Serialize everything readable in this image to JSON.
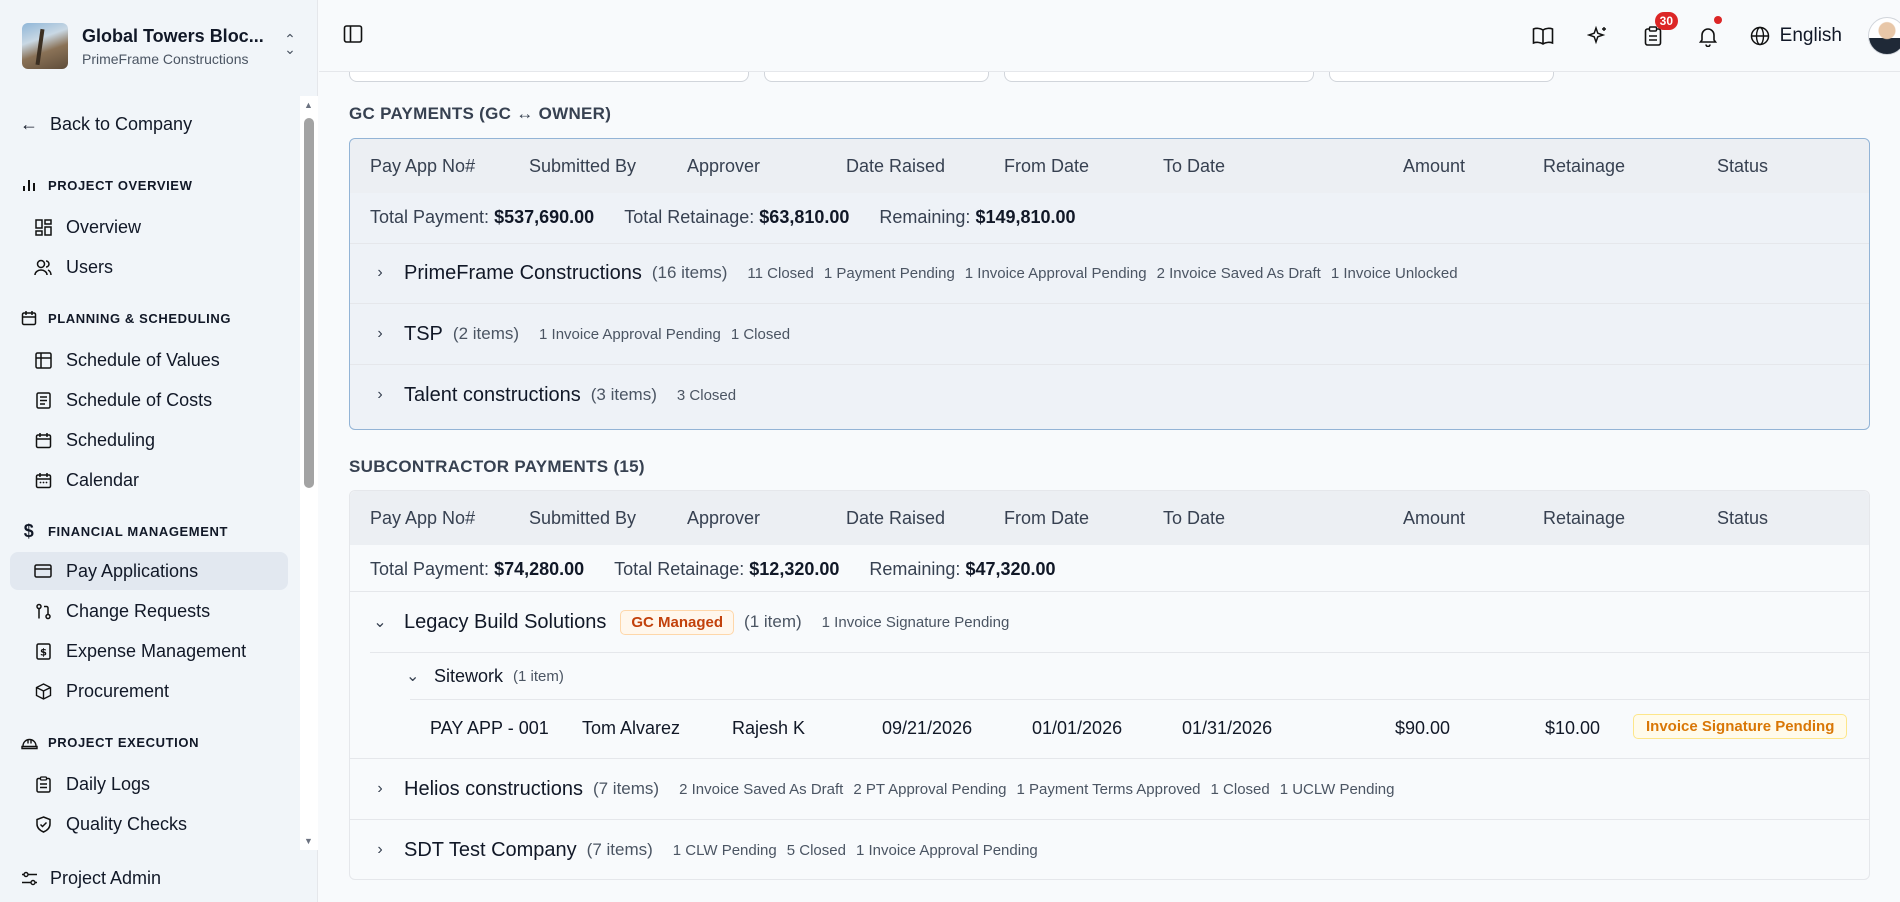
{
  "project": {
    "name": "Global Towers Bloc...",
    "company": "PrimeFrame Constructions"
  },
  "sidebar": {
    "back_label": "Back to Company",
    "sections": [
      {
        "title": "PROJECT OVERVIEW",
        "items": [
          "Overview",
          "Users"
        ]
      },
      {
        "title": "PLANNING & SCHEDULING",
        "items": [
          "Schedule of Values",
          "Schedule of Costs",
          "Scheduling",
          "Calendar"
        ]
      },
      {
        "title": "FINANCIAL MANAGEMENT",
        "items": [
          "Pay Applications",
          "Change Requests",
          "Expense Management",
          "Procurement"
        ]
      },
      {
        "title": "PROJECT EXECUTION",
        "items": [
          "Daily Logs",
          "Quality Checks"
        ]
      }
    ],
    "active_item": "Pay Applications",
    "project_admin": "Project Admin"
  },
  "topbar": {
    "notification_count": "30",
    "language": "English"
  },
  "columns": [
    "Pay App No#",
    "Submitted By",
    "Approver",
    "Date Raised",
    "From Date",
    "To Date",
    "Amount",
    "Retainage",
    "Status"
  ],
  "gc_payments": {
    "title": "GC PAYMENTS (GC ↔ OWNER)",
    "totals": {
      "payment_label": "Total Payment:",
      "payment": "$537,690.00",
      "retainage_label": "Total Retainage:",
      "retainage": "$63,810.00",
      "remaining_label": "Remaining:",
      "remaining": "$149,810.00"
    },
    "groups": [
      {
        "name": "PrimeFrame Constructions",
        "count": "(16 items)",
        "stats": [
          "11 Closed",
          "1 Payment Pending",
          "1 Invoice Approval Pending",
          "2 Invoice Saved As Draft",
          "1 Invoice Unlocked"
        ]
      },
      {
        "name": "TSP",
        "count": "(2 items)",
        "stats": [
          "1 Invoice Approval Pending",
          "1 Closed"
        ]
      },
      {
        "name": "Talent constructions",
        "count": "(3 items)",
        "stats": [
          "3 Closed"
        ]
      }
    ]
  },
  "sub_payments": {
    "title": "SUBCONTRACTOR PAYMENTS (15)",
    "totals": {
      "payment_label": "Total Payment:",
      "payment": "$74,280.00",
      "retainage_label": "Total Retainage:",
      "retainage": "$12,320.00",
      "remaining_label": "Remaining:",
      "remaining": "$47,320.00"
    },
    "expanded_group": {
      "name": "Legacy Build Solutions",
      "badge": "GC Managed",
      "count": "(1 item)",
      "stats": [
        "1 Invoice Signature Pending"
      ],
      "subgroup": {
        "name": "Sitework",
        "count": "(1 item)"
      },
      "row": {
        "pay_app": "PAY APP - 001",
        "submitted_by": "Tom Alvarez",
        "approver": "Rajesh K",
        "date_raised": "09/21/2026",
        "from_date": "01/01/2026",
        "to_date": "01/31/2026",
        "amount": "$90.00",
        "retainage": "$10.00",
        "status": "Invoice Signature Pending"
      }
    },
    "groups": [
      {
        "name": "Helios constructions",
        "count": "(7 items)",
        "stats": [
          "2 Invoice Saved As Draft",
          "2 PT Approval Pending",
          "1 Payment Terms Approved",
          "1 Closed",
          "1 UCLW Pending"
        ]
      },
      {
        "name": "SDT Test Company",
        "count": "(7 items)",
        "stats": [
          "1 CLW Pending",
          "5 Closed",
          "1 Invoice Approval Pending"
        ]
      }
    ]
  }
}
